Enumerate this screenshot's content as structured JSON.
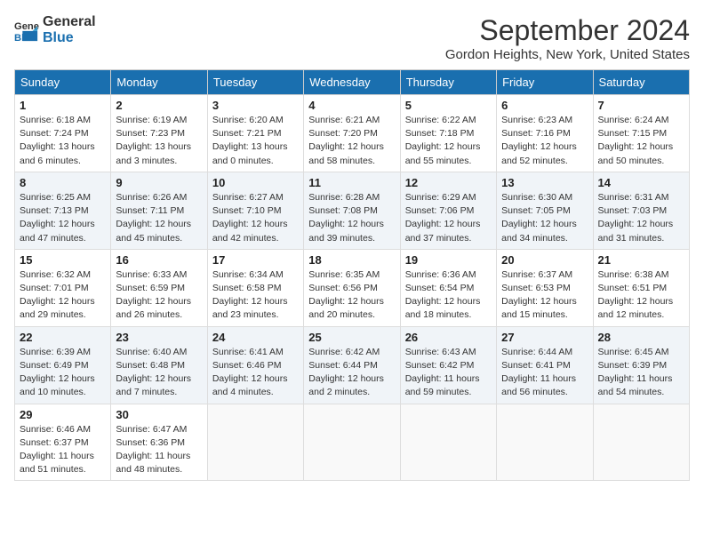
{
  "logo": {
    "text_general": "General",
    "text_blue": "Blue"
  },
  "title": "September 2024",
  "location": "Gordon Heights, New York, United States",
  "weekdays": [
    "Sunday",
    "Monday",
    "Tuesday",
    "Wednesday",
    "Thursday",
    "Friday",
    "Saturday"
  ],
  "weeks": [
    [
      {
        "day": "1",
        "sunrise": "Sunrise: 6:18 AM",
        "sunset": "Sunset: 7:24 PM",
        "daylight": "Daylight: 13 hours and 6 minutes."
      },
      {
        "day": "2",
        "sunrise": "Sunrise: 6:19 AM",
        "sunset": "Sunset: 7:23 PM",
        "daylight": "Daylight: 13 hours and 3 minutes."
      },
      {
        "day": "3",
        "sunrise": "Sunrise: 6:20 AM",
        "sunset": "Sunset: 7:21 PM",
        "daylight": "Daylight: 13 hours and 0 minutes."
      },
      {
        "day": "4",
        "sunrise": "Sunrise: 6:21 AM",
        "sunset": "Sunset: 7:20 PM",
        "daylight": "Daylight: 12 hours and 58 minutes."
      },
      {
        "day": "5",
        "sunrise": "Sunrise: 6:22 AM",
        "sunset": "Sunset: 7:18 PM",
        "daylight": "Daylight: 12 hours and 55 minutes."
      },
      {
        "day": "6",
        "sunrise": "Sunrise: 6:23 AM",
        "sunset": "Sunset: 7:16 PM",
        "daylight": "Daylight: 12 hours and 52 minutes."
      },
      {
        "day": "7",
        "sunrise": "Sunrise: 6:24 AM",
        "sunset": "Sunset: 7:15 PM",
        "daylight": "Daylight: 12 hours and 50 minutes."
      }
    ],
    [
      {
        "day": "8",
        "sunrise": "Sunrise: 6:25 AM",
        "sunset": "Sunset: 7:13 PM",
        "daylight": "Daylight: 12 hours and 47 minutes."
      },
      {
        "day": "9",
        "sunrise": "Sunrise: 6:26 AM",
        "sunset": "Sunset: 7:11 PM",
        "daylight": "Daylight: 12 hours and 45 minutes."
      },
      {
        "day": "10",
        "sunrise": "Sunrise: 6:27 AM",
        "sunset": "Sunset: 7:10 PM",
        "daylight": "Daylight: 12 hours and 42 minutes."
      },
      {
        "day": "11",
        "sunrise": "Sunrise: 6:28 AM",
        "sunset": "Sunset: 7:08 PM",
        "daylight": "Daylight: 12 hours and 39 minutes."
      },
      {
        "day": "12",
        "sunrise": "Sunrise: 6:29 AM",
        "sunset": "Sunset: 7:06 PM",
        "daylight": "Daylight: 12 hours and 37 minutes."
      },
      {
        "day": "13",
        "sunrise": "Sunrise: 6:30 AM",
        "sunset": "Sunset: 7:05 PM",
        "daylight": "Daylight: 12 hours and 34 minutes."
      },
      {
        "day": "14",
        "sunrise": "Sunrise: 6:31 AM",
        "sunset": "Sunset: 7:03 PM",
        "daylight": "Daylight: 12 hours and 31 minutes."
      }
    ],
    [
      {
        "day": "15",
        "sunrise": "Sunrise: 6:32 AM",
        "sunset": "Sunset: 7:01 PM",
        "daylight": "Daylight: 12 hours and 29 minutes."
      },
      {
        "day": "16",
        "sunrise": "Sunrise: 6:33 AM",
        "sunset": "Sunset: 6:59 PM",
        "daylight": "Daylight: 12 hours and 26 minutes."
      },
      {
        "day": "17",
        "sunrise": "Sunrise: 6:34 AM",
        "sunset": "Sunset: 6:58 PM",
        "daylight": "Daylight: 12 hours and 23 minutes."
      },
      {
        "day": "18",
        "sunrise": "Sunrise: 6:35 AM",
        "sunset": "Sunset: 6:56 PM",
        "daylight": "Daylight: 12 hours and 20 minutes."
      },
      {
        "day": "19",
        "sunrise": "Sunrise: 6:36 AM",
        "sunset": "Sunset: 6:54 PM",
        "daylight": "Daylight: 12 hours and 18 minutes."
      },
      {
        "day": "20",
        "sunrise": "Sunrise: 6:37 AM",
        "sunset": "Sunset: 6:53 PM",
        "daylight": "Daylight: 12 hours and 15 minutes."
      },
      {
        "day": "21",
        "sunrise": "Sunrise: 6:38 AM",
        "sunset": "Sunset: 6:51 PM",
        "daylight": "Daylight: 12 hours and 12 minutes."
      }
    ],
    [
      {
        "day": "22",
        "sunrise": "Sunrise: 6:39 AM",
        "sunset": "Sunset: 6:49 PM",
        "daylight": "Daylight: 12 hours and 10 minutes."
      },
      {
        "day": "23",
        "sunrise": "Sunrise: 6:40 AM",
        "sunset": "Sunset: 6:48 PM",
        "daylight": "Daylight: 12 hours and 7 minutes."
      },
      {
        "day": "24",
        "sunrise": "Sunrise: 6:41 AM",
        "sunset": "Sunset: 6:46 PM",
        "daylight": "Daylight: 12 hours and 4 minutes."
      },
      {
        "day": "25",
        "sunrise": "Sunrise: 6:42 AM",
        "sunset": "Sunset: 6:44 PM",
        "daylight": "Daylight: 12 hours and 2 minutes."
      },
      {
        "day": "26",
        "sunrise": "Sunrise: 6:43 AM",
        "sunset": "Sunset: 6:42 PM",
        "daylight": "Daylight: 11 hours and 59 minutes."
      },
      {
        "day": "27",
        "sunrise": "Sunrise: 6:44 AM",
        "sunset": "Sunset: 6:41 PM",
        "daylight": "Daylight: 11 hours and 56 minutes."
      },
      {
        "day": "28",
        "sunrise": "Sunrise: 6:45 AM",
        "sunset": "Sunset: 6:39 PM",
        "daylight": "Daylight: 11 hours and 54 minutes."
      }
    ],
    [
      {
        "day": "29",
        "sunrise": "Sunrise: 6:46 AM",
        "sunset": "Sunset: 6:37 PM",
        "daylight": "Daylight: 11 hours and 51 minutes."
      },
      {
        "day": "30",
        "sunrise": "Sunrise: 6:47 AM",
        "sunset": "Sunset: 6:36 PM",
        "daylight": "Daylight: 11 hours and 48 minutes."
      },
      null,
      null,
      null,
      null,
      null
    ]
  ]
}
